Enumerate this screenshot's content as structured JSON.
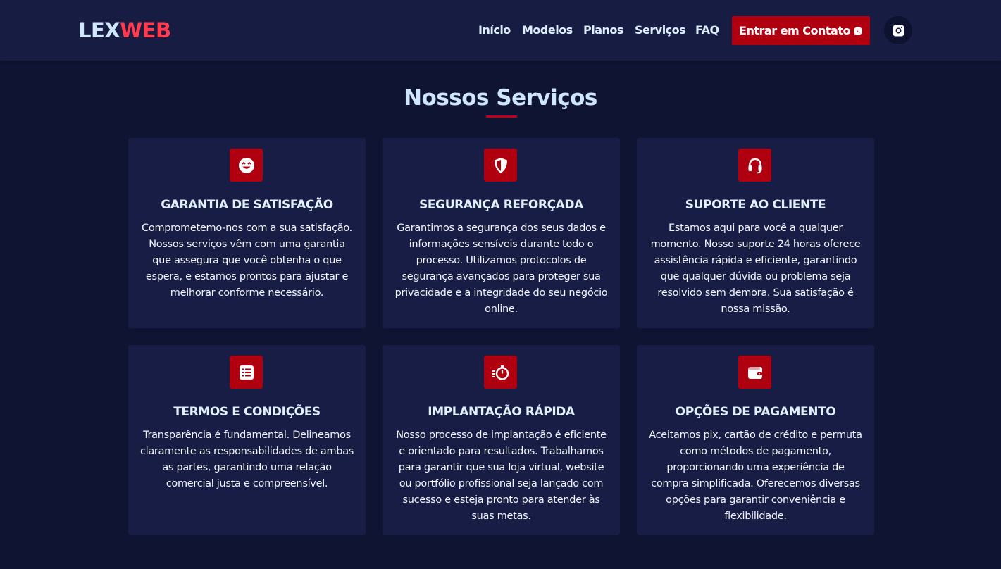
{
  "header": {
    "logo": {
      "part1": "LEX",
      "part2": "WEB"
    },
    "nav": [
      {
        "label": "Início"
      },
      {
        "label": "Modelos"
      },
      {
        "label": "Planos"
      },
      {
        "label": "Serviços"
      },
      {
        "label": "FAQ"
      }
    ],
    "cta_label": "Entrar em Contato",
    "cta_icon": "whatsapp-icon",
    "social_icon": "instagram-icon"
  },
  "section": {
    "title": "Nossos Serviços"
  },
  "services": [
    {
      "icon": "smile-icon",
      "title": "GARANTIA DE SATISFAÇÃO",
      "text": "Comprometemo-nos com a sua satisfação. Nossos serviços vêm com uma garantia que assegura que você obtenha o que espera, e estamos prontos para ajustar e melhorar conforme necessário."
    },
    {
      "icon": "shield-icon",
      "title": "SEGURANÇA REFORÇADA",
      "text": "Garantimos a segurança dos seus dados e informações sensíveis durante todo o processo. Utilizamos protocolos de segurança avançados para proteger sua privacidade e a integridade do seu negócio online."
    },
    {
      "icon": "headset-icon",
      "title": "SUPORTE AO CLIENTE",
      "text": "Estamos aqui para você a qualquer momento. Nosso suporte 24 horas oferece assistência rápida e eficiente, garantindo que qualquer dúvida ou problema seja resolvido sem demora. Sua satisfação é nossa missão."
    },
    {
      "icon": "list-icon",
      "title": "TERMOS E CONDIÇÕES",
      "text": "Transparência é fundamental. Delineamos claramente as responsabilidades de ambas as partes, garantindo uma relação comercial justa e compreensível."
    },
    {
      "icon": "stopwatch-icon",
      "title": "IMPLANTAÇÃO RÁPIDA",
      "text": "Nosso processo de implantação é eficiente e orientado para resultados. Trabalhamos para garantir que sua loja virtual, website ou portfólio profissional seja lançado com sucesso e esteja pronto para atender às suas metas."
    },
    {
      "icon": "wallet-icon",
      "title": "OPÇÕES DE PAGAMENTO",
      "text": "Aceitamos pix, cartão de crédito e permuta como métodos de pagamento, proporcionando uma experiência de compra simplificada. Oferecemos diversas opções para garantir conveniência e flexibilidade."
    }
  ],
  "colors": {
    "background": "#0f1433",
    "header": "#161c42",
    "card": "#171d44",
    "accent": "#b00010",
    "logo_light": "#cfe6ff",
    "logo_red": "#ff3b4d"
  }
}
